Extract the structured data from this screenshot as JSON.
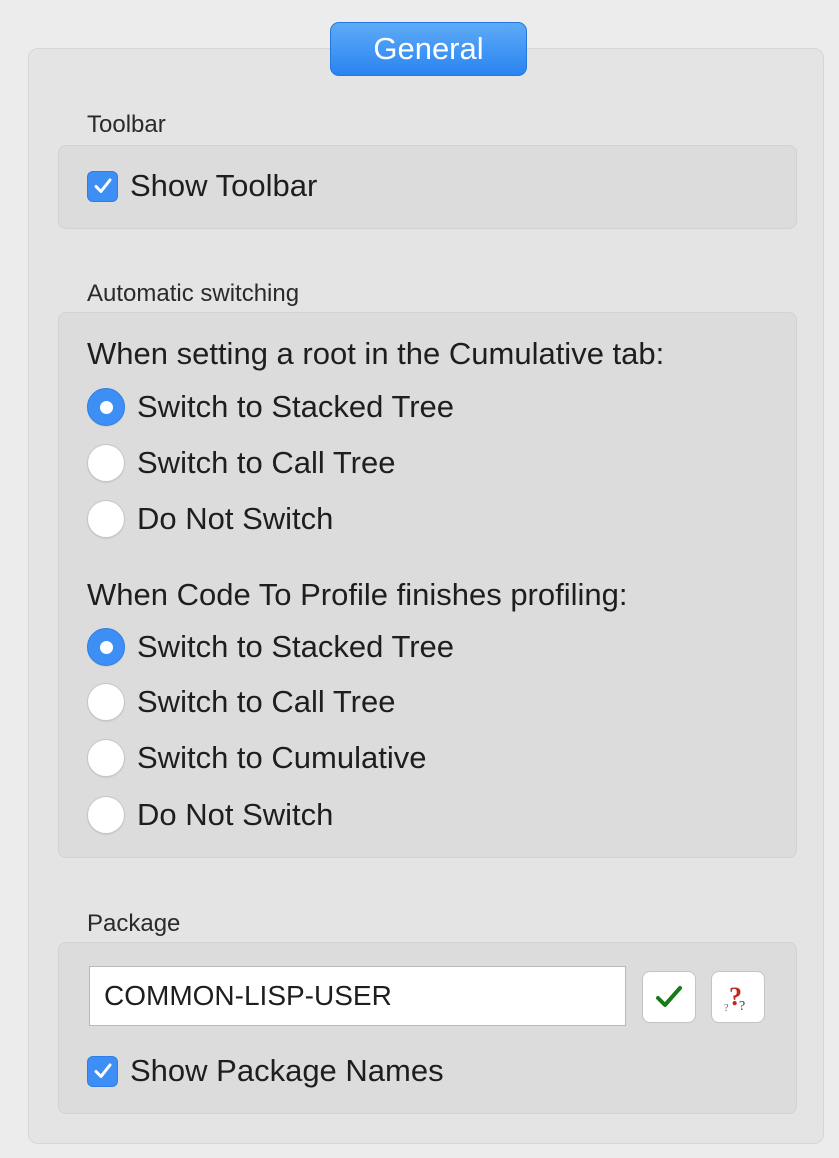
{
  "tab": {
    "label": "General"
  },
  "toolbar": {
    "section_label": "Toolbar",
    "show_toolbar": {
      "label": "Show Toolbar",
      "checked": true
    }
  },
  "switching": {
    "section_label": "Automatic switching",
    "cumulative": {
      "question": "When setting a root in the Cumulative tab:",
      "options": [
        {
          "label": "Switch to Stacked Tree",
          "selected": true
        },
        {
          "label": "Switch to Call Tree",
          "selected": false
        },
        {
          "label": "Do Not Switch",
          "selected": false
        }
      ]
    },
    "profile": {
      "question": "When Code To Profile finishes profiling:",
      "options": [
        {
          "label": "Switch to Stacked Tree",
          "selected": true
        },
        {
          "label": "Switch to Call Tree",
          "selected": false
        },
        {
          "label": "Switch to Cumulative",
          "selected": false
        },
        {
          "label": "Do Not Switch",
          "selected": false
        }
      ]
    }
  },
  "package": {
    "section_label": "Package",
    "input_value": "COMMON-LISP-USER",
    "show_package_names": {
      "label": "Show Package Names",
      "checked": true
    },
    "icons": {
      "accept": "checkmark-icon",
      "help": "question-mark-icon"
    }
  },
  "colors": {
    "accent": "#3d8ff5",
    "tab_gradient_top": "#5eaaf7",
    "tab_gradient_bottom": "#2a84f1",
    "checkmark_green": "#1a7a1a",
    "question_red": "#c0281e"
  }
}
